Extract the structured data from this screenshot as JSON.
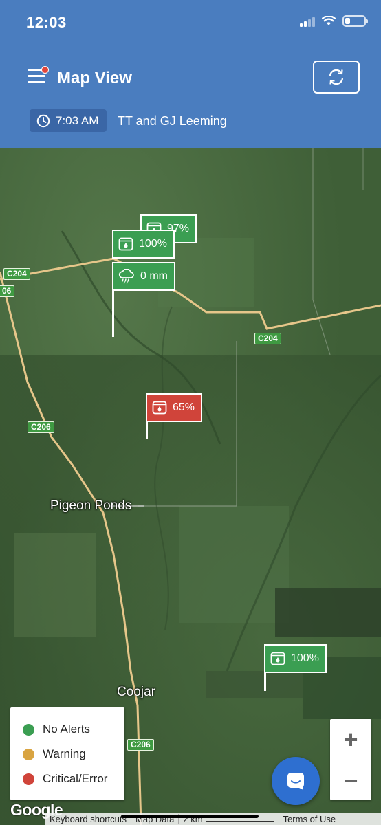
{
  "status_bar": {
    "time": "12:03"
  },
  "header": {
    "title": "Map View",
    "time_chip": "7:03 AM",
    "farm_name": "TT and GJ Leeming"
  },
  "map": {
    "road_labels": [
      "C204",
      "06",
      "C204",
      "C206",
      "C206"
    ],
    "place_labels": [
      "Pigeon Ponds",
      "Coojar"
    ],
    "markers": [
      {
        "kind": "tank",
        "value": "97%",
        "status": "green"
      },
      {
        "kind": "tank",
        "value": "100%",
        "status": "green"
      },
      {
        "kind": "rain",
        "value": "0 mm",
        "status": "green"
      },
      {
        "kind": "tank",
        "value": "65%",
        "status": "red"
      },
      {
        "kind": "tank",
        "value": "100%",
        "status": "green"
      }
    ]
  },
  "legend": {
    "items": [
      {
        "label": "No Alerts",
        "color": "#3b9e52"
      },
      {
        "label": "Warning",
        "color": "#d9a441"
      },
      {
        "label": "Critical/Error",
        "color": "#d0443a"
      }
    ]
  },
  "zoom": {
    "in": "+",
    "out": "−"
  },
  "attribution": {
    "logo": "Google",
    "shortcuts": "Keyboard shortcuts",
    "map_data": "Map Data",
    "scale": "2 km",
    "terms": "Terms of Use"
  },
  "colors": {
    "header": "#4a7dbf",
    "ok": "#3b9e52",
    "critical": "#d0443a",
    "chat": "#2e6fd0"
  },
  "icons": [
    "menu-icon",
    "refresh-icon",
    "clock-icon",
    "tank-icon",
    "rain-cloud-icon",
    "chat-icon"
  ]
}
